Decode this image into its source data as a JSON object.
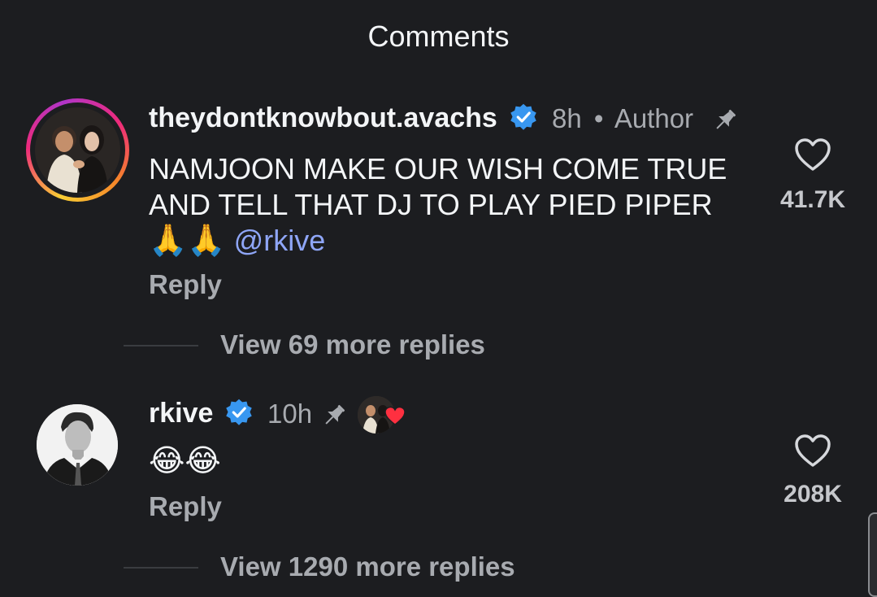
{
  "header": {
    "title": "Comments"
  },
  "comments": [
    {
      "username": "theydontknowbout.avachs",
      "time": "8h",
      "separator": "•",
      "role": "Author",
      "text": "NAMJOON MAKE OUR WISH COME TRUE AND TELL THAT DJ TO PLAY PIED PIPER",
      "emojis": "🙏🙏",
      "mention": "@rkive",
      "reply_label": "Reply",
      "likes": "41.7K",
      "view_replies": "View 69 more replies"
    },
    {
      "username": "rkive",
      "time": "10h",
      "emojis": "😂😂",
      "reply_label": "Reply",
      "likes": "208K",
      "view_replies": "View 1290 more replies"
    }
  ],
  "colors": {
    "background": "#1c1d20",
    "verified": "#3897f0",
    "mention": "#8fa6f7",
    "heart_red": "#ff3040"
  },
  "icons": [
    "verified-badge-icon",
    "pin-icon",
    "heart-outline-icon",
    "heart-filled-icon"
  ]
}
